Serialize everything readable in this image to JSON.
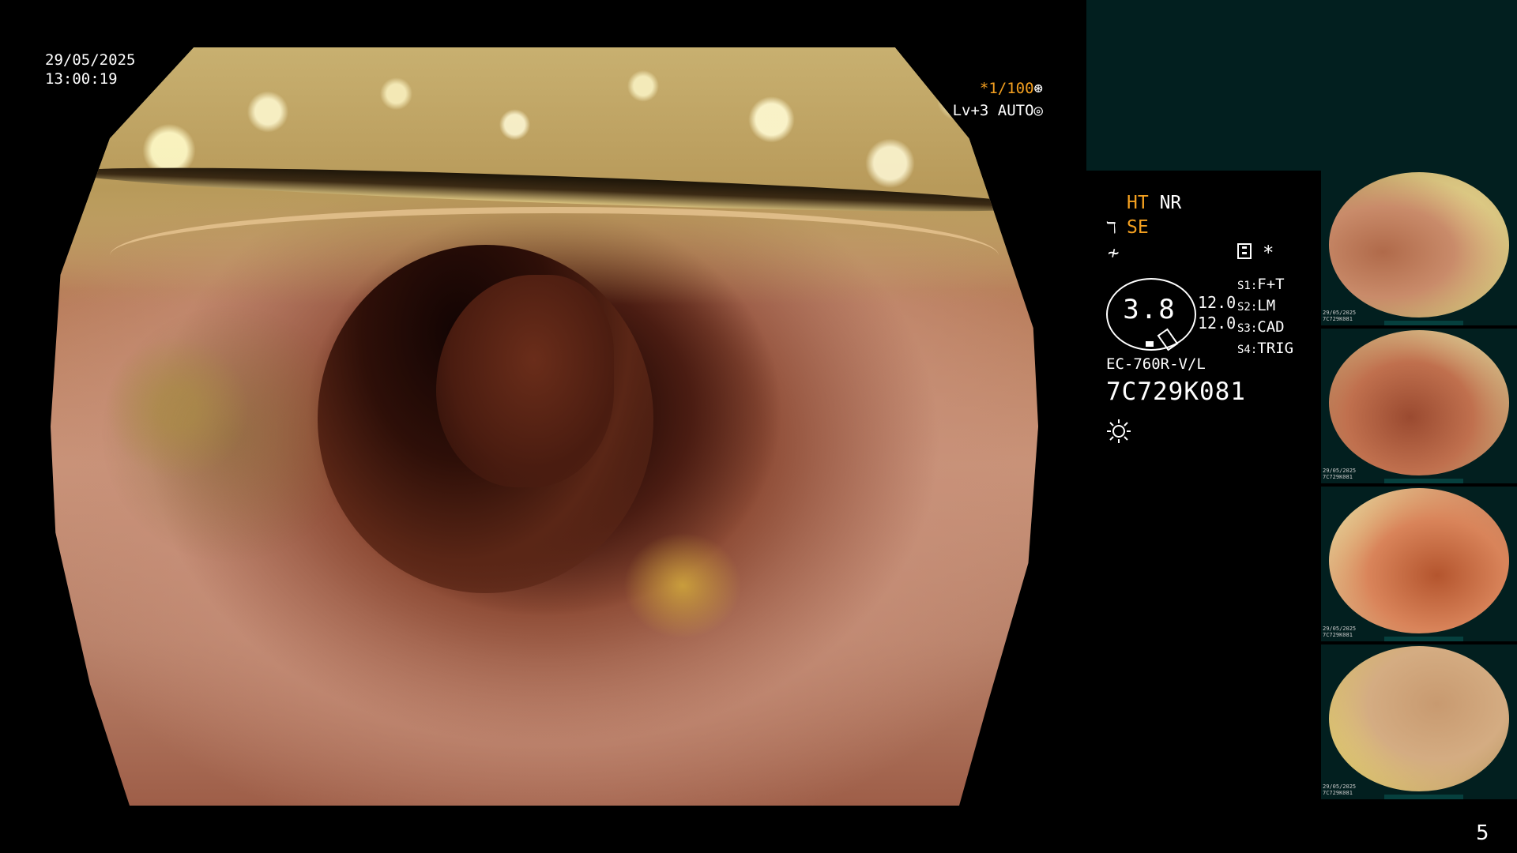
{
  "overlay": {
    "date": "29/05/2025",
    "time": "13:00:19",
    "shutter": "*1/100",
    "level": "Lv+3 AUTO"
  },
  "status": {
    "ht": "HT",
    "nr": "NR",
    "se": "SE"
  },
  "gauge": {
    "value": "3.8"
  },
  "numbers": [
    "12.0",
    "12.0"
  ],
  "settings": [
    {
      "key": "S1:",
      "value": "F+T"
    },
    {
      "key": "S2:",
      "value": "LM"
    },
    {
      "key": "S3:",
      "value": "CAD"
    },
    {
      "key": "S4:",
      "value": "TRIG"
    }
  ],
  "scope": {
    "model": "EC-760R-V/L",
    "serial": "7C729K081"
  },
  "thumbnails": [
    {
      "meta": "29/05/2025\n7C729K081"
    },
    {
      "meta": "29/05/2025\n7C729K081"
    },
    {
      "meta": "29/05/2025\n7C729K081"
    },
    {
      "meta": "29/05/2025\n7C729K081"
    }
  ],
  "page_number": "5",
  "colors": {
    "accent_orange": "#f4a020",
    "panel_teal": "#021f1f"
  }
}
